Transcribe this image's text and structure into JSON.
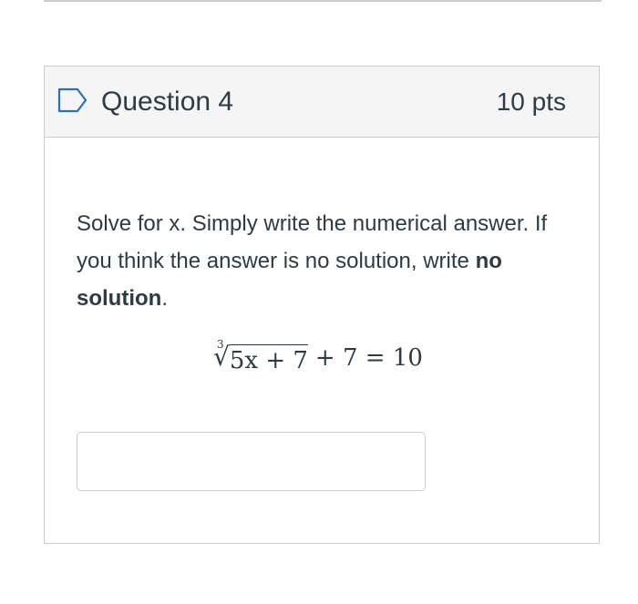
{
  "question": {
    "title": "Question 4",
    "points": "10 pts",
    "flag_icon": "bookmark-flag-icon",
    "text_before_bold": "Solve for x. Simply write the numerical answer. If you think the answer is no solution, write ",
    "text_bold": "no solution",
    "text_after_bold": ".",
    "equation": {
      "radical_index": "3",
      "radicand": "5x + 7",
      "rest": "+ 7 = 10"
    },
    "answer": {
      "value": "",
      "placeholder": ""
    }
  },
  "colors": {
    "header_background": "#f5f5f5",
    "border": "#c7cdd1",
    "text": "#2d3b45",
    "flag_icon": "#2d70b3"
  }
}
